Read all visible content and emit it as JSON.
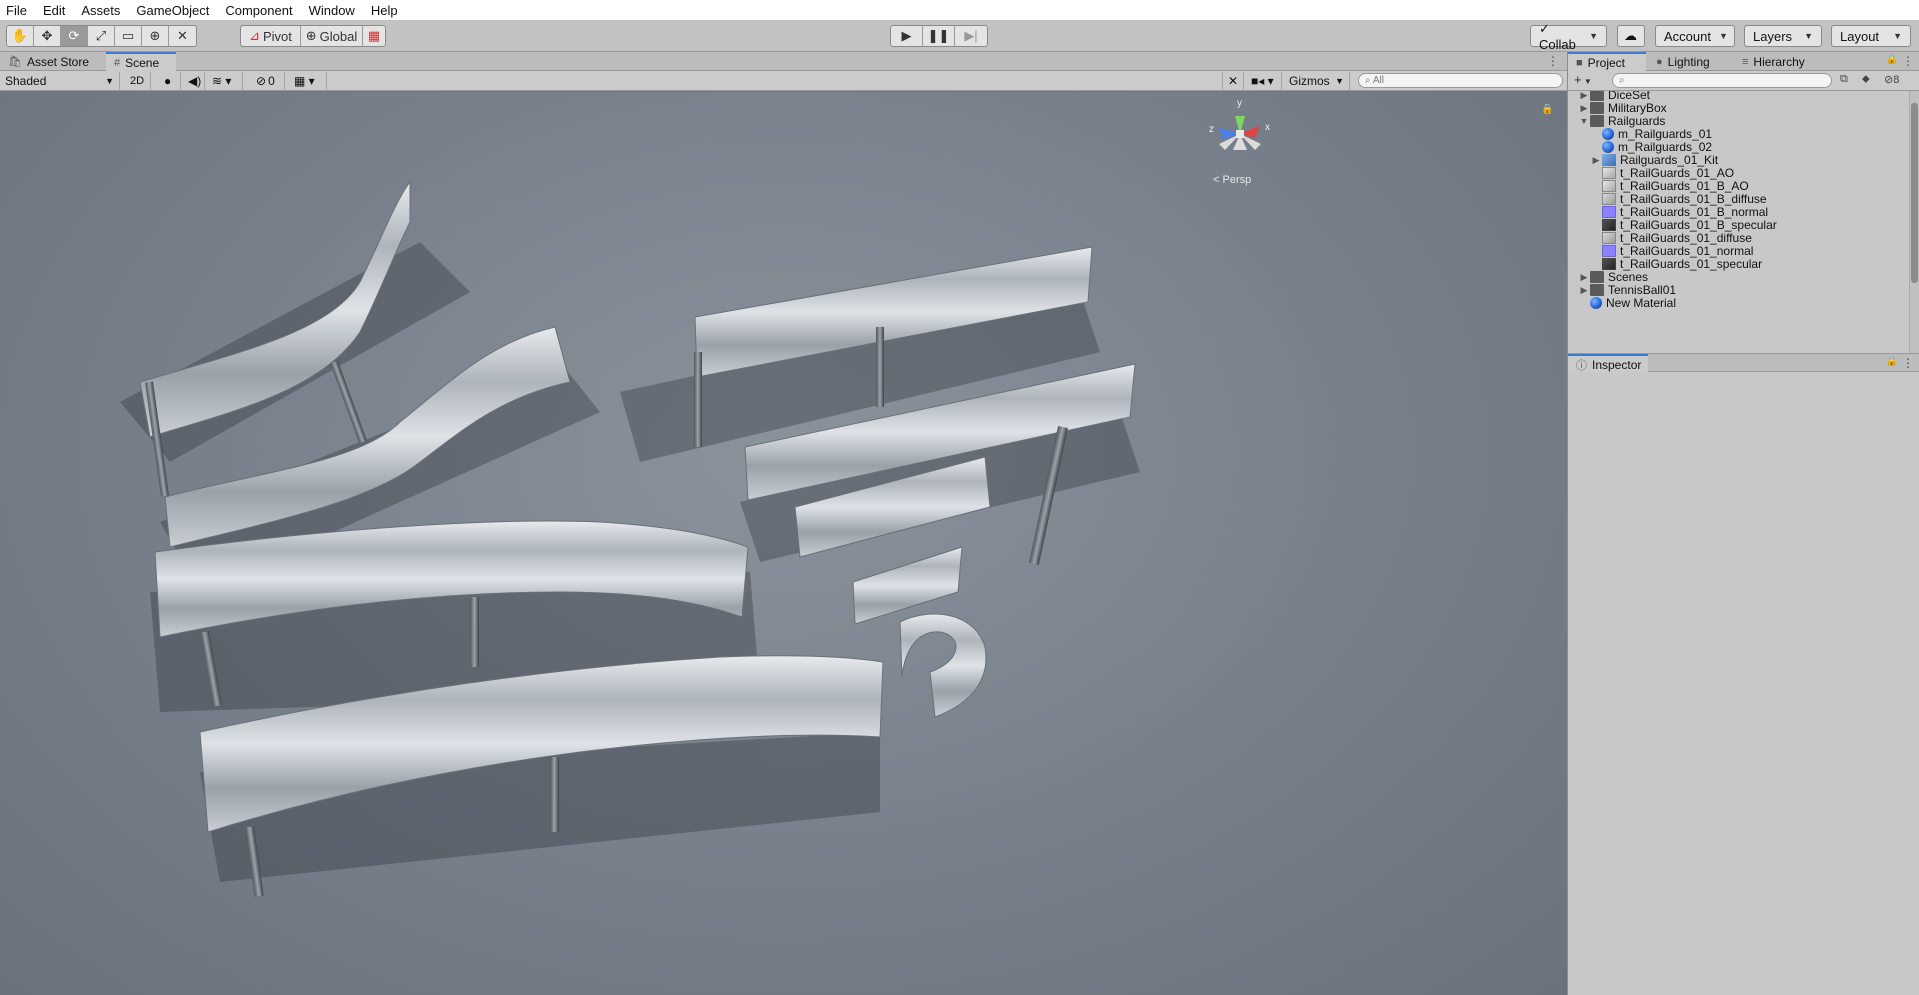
{
  "menu": {
    "items": [
      "File",
      "Edit",
      "Assets",
      "GameObject",
      "Component",
      "Window",
      "Help"
    ]
  },
  "toolbar": {
    "tools": [
      {
        "icon": "hand-tool-icon",
        "glyph": "✋"
      },
      {
        "icon": "move-tool-icon",
        "glyph": "✥"
      },
      {
        "icon": "rotate-tool-icon",
        "glyph": "⟳"
      },
      {
        "icon": "scale-tool-icon",
        "glyph": "⤢"
      },
      {
        "icon": "rect-tool-icon",
        "glyph": "▭"
      },
      {
        "icon": "transform-tool-icon",
        "glyph": "⊕"
      },
      {
        "icon": "custom-tool-icon",
        "glyph": "✕"
      }
    ],
    "pivot_label": "Pivot",
    "global_label": "Global",
    "collab_label": "Collab",
    "account_label": "Account",
    "layers_label": "Layers",
    "layout_label": "Layout"
  },
  "scene": {
    "tabs": [
      {
        "label": "Asset Store",
        "icon": "asset-store-icon"
      },
      {
        "label": "Scene",
        "icon": "scene-grid-icon"
      }
    ],
    "draw_mode": "Shaded",
    "mode_2d": "2D",
    "hidden_count": "0",
    "gizmos_label": "Gizmos",
    "search_placeholder": "All",
    "persp_label": "Persp",
    "axis_labels": {
      "y": "y",
      "z": "z",
      "x": "x"
    }
  },
  "project": {
    "tabs": [
      {
        "label": "Project",
        "icon": "folder-tab-icon"
      },
      {
        "label": "Lighting",
        "icon": "light-bulb-icon"
      },
      {
        "label": "Hierarchy",
        "icon": "hierarchy-list-icon"
      }
    ],
    "layer_count": "8",
    "tree": [
      {
        "label": "DiceSet",
        "type": "folder",
        "indent": 0,
        "arrow": "▶"
      },
      {
        "label": "MilitaryBox",
        "type": "folder",
        "indent": 0,
        "arrow": "▶"
      },
      {
        "label": "Railguards",
        "type": "folder-open",
        "indent": 0,
        "arrow": "▼"
      },
      {
        "label": "m_Railguards_01",
        "type": "mat",
        "indent": 1,
        "arrow": ""
      },
      {
        "label": "m_Railguards_02",
        "type": "mat",
        "indent": 1,
        "arrow": ""
      },
      {
        "label": "Railguards_01_Kit",
        "type": "prefab",
        "indent": 1,
        "arrow": "▶"
      },
      {
        "label": "t_RailGuards_01_AO",
        "type": "tex-ao",
        "indent": 1,
        "arrow": ""
      },
      {
        "label": "t_RailGuards_01_B_AO",
        "type": "tex-ao",
        "indent": 1,
        "arrow": ""
      },
      {
        "label": "t_RailGuards_01_B_diffuse",
        "type": "tex-diffuse",
        "indent": 1,
        "arrow": ""
      },
      {
        "label": "t_RailGuards_01_B_normal",
        "type": "tex-normal",
        "indent": 1,
        "arrow": ""
      },
      {
        "label": "t_RailGuards_01_B_specular",
        "type": "tex-spec",
        "indent": 1,
        "arrow": ""
      },
      {
        "label": "t_RailGuards_01_diffuse",
        "type": "tex-diffuse",
        "indent": 1,
        "arrow": ""
      },
      {
        "label": "t_RailGuards_01_normal",
        "type": "tex-normal",
        "indent": 1,
        "arrow": ""
      },
      {
        "label": "t_RailGuards_01_specular",
        "type": "tex-spec",
        "indent": 1,
        "arrow": ""
      },
      {
        "label": "Scenes",
        "type": "folder",
        "indent": 0,
        "arrow": "▶"
      },
      {
        "label": "TennisBall01",
        "type": "folder",
        "indent": 0,
        "arrow": "▶"
      },
      {
        "label": "New Material",
        "type": "mat",
        "indent": 0,
        "arrow": ""
      }
    ]
  },
  "inspector": {
    "tab_label": "Inspector"
  },
  "colors": {
    "accent": "#3a7bd5",
    "scene_bg": "#7a828d",
    "panel_bg": "#c8c8c8"
  }
}
